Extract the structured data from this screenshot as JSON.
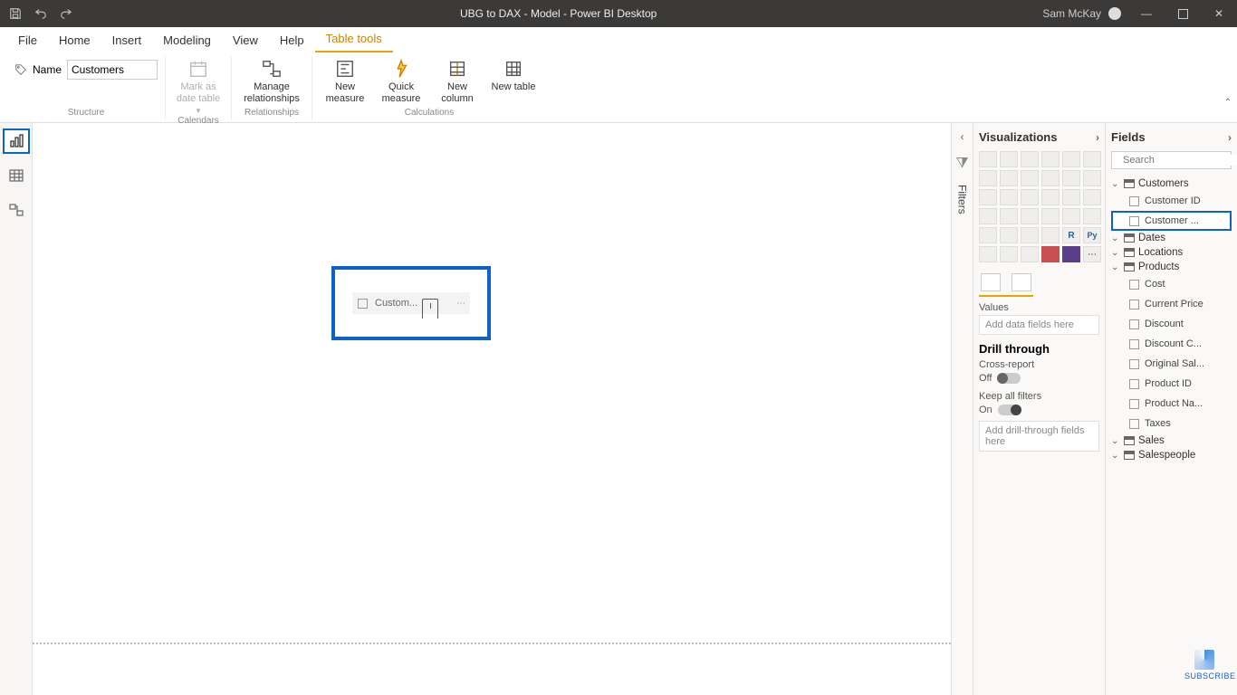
{
  "titlebar": {
    "title": "UBG to DAX - Model - Power BI Desktop",
    "user": "Sam McKay"
  },
  "ribbonTabs": {
    "file": "File",
    "home": "Home",
    "insert": "Insert",
    "modeling": "Modeling",
    "view": "View",
    "help": "Help",
    "tabletools": "Table tools"
  },
  "ribbon": {
    "nameLabel": "Name",
    "nameValue": "Customers",
    "markAsDate": "Mark as date table",
    "manageRel": "Manage relationships",
    "newMeasure": "New measure",
    "quickMeasure": "Quick measure",
    "newColumn": "New column",
    "newTable": "New table",
    "groups": {
      "structure": "Structure",
      "calendars": "Calendars",
      "relationships": "Relationships",
      "calculations": "Calculations"
    }
  },
  "canvas": {
    "visualFieldLabel": "Custom..."
  },
  "filters": {
    "label": "Filters"
  },
  "viz": {
    "header": "Visualizations",
    "valuesLabel": "Values",
    "addData": "Add data fields here",
    "drillHeader": "Drill through",
    "crossReport": "Cross-report",
    "off": "Off",
    "keepAll": "Keep all filters",
    "on": "On",
    "addDrill": "Add drill-through fields here"
  },
  "fields": {
    "header": "Fields",
    "searchPlaceholder": "Search",
    "tables": {
      "customers": {
        "name": "Customers",
        "fields": [
          "Customer ID",
          "Customer ..."
        ]
      },
      "dates": {
        "name": "Dates"
      },
      "locations": {
        "name": "Locations"
      },
      "products": {
        "name": "Products",
        "fields": [
          "Cost",
          "Current Price",
          "Discount",
          "Discount C...",
          "Original Sal...",
          "Product ID",
          "Product Na...",
          "Taxes"
        ]
      },
      "sales": {
        "name": "Sales"
      },
      "salespeople": {
        "name": "Salespeople"
      }
    }
  },
  "subscribe": "SUBSCRIBE"
}
